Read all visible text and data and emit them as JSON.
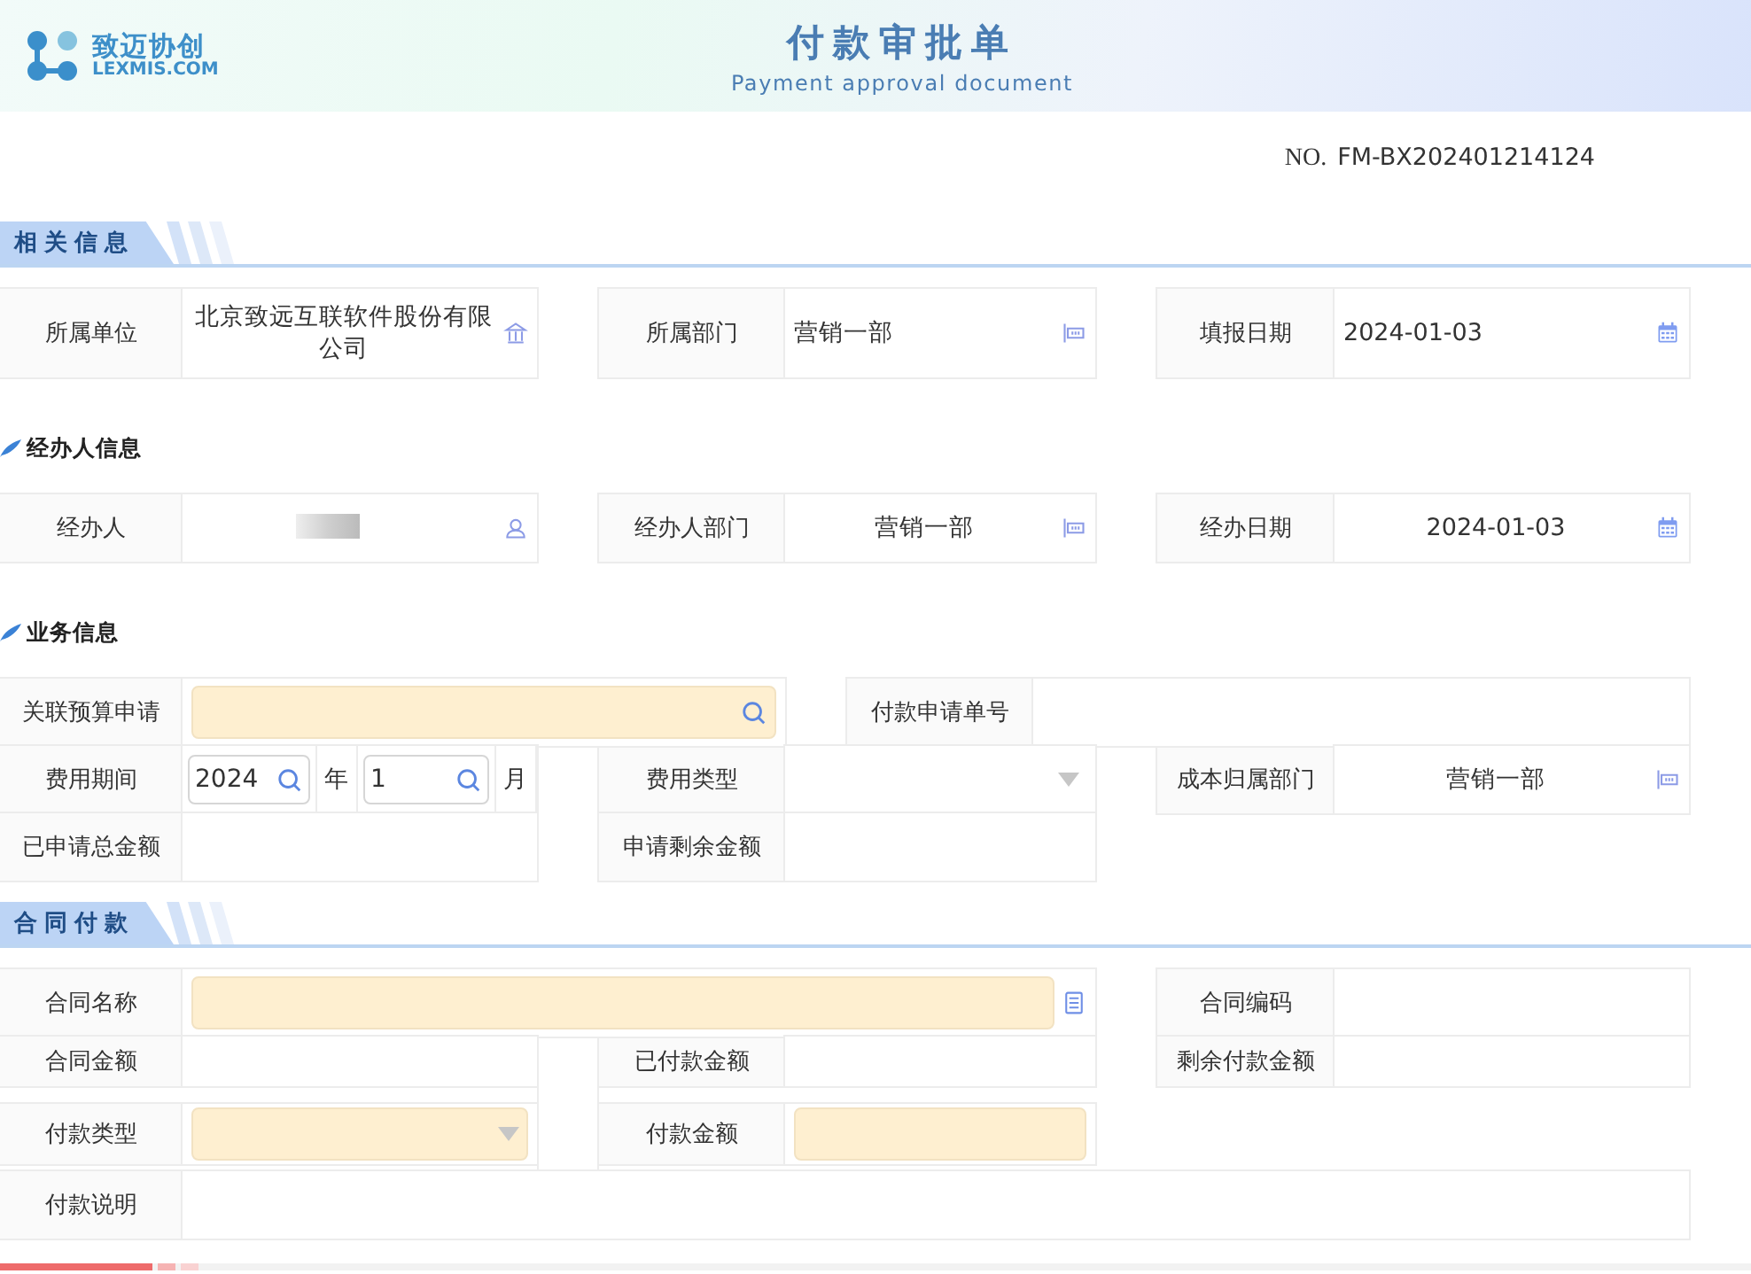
{
  "header": {
    "logo_name": "致迈协创",
    "logo_domain": "LEXMIS.COM",
    "title": "付款审批单",
    "subtitle": "Payment approval document"
  },
  "document_number": {
    "prefix": "NO.",
    "value": "FM-BX202401214124"
  },
  "sections": [
    {
      "kind": "banner",
      "title": "相关信息",
      "rows": [
        {
          "kind": "triple",
          "fields": [
            {
              "label": "所属单位",
              "value": {
                "kind": "company_picker",
                "text": "北京致远互联软件股份有限公司",
                "centered": true
              }
            },
            {
              "label": "所属部门",
              "value": {
                "kind": "department_picker",
                "text": "营销一部",
                "centered": false
              }
            },
            {
              "label": "填报日期",
              "value": {
                "kind": "date_picker",
                "text": "2024-01-03",
                "centered": false
              }
            }
          ]
        }
      ]
    },
    {
      "kind": "subheading",
      "title": "经办人信息",
      "rows": [
        {
          "kind": "triple",
          "fields": [
            {
              "label": "经办人",
              "value": {
                "kind": "person_picker"
              }
            },
            {
              "label": "经办人部门",
              "value": {
                "kind": "department_picker",
                "text": "营销一部",
                "centered": true
              }
            },
            {
              "label": "经办日期",
              "value": {
                "kind": "date_picker",
                "text": "2024-01-03",
                "centered": true
              }
            }
          ]
        }
      ]
    },
    {
      "kind": "subheading",
      "title": "业务信息",
      "rows": [
        {
          "kind": "budget",
          "fields": [
            {
              "label": "关联预算申请",
              "value": {
                "kind": "lookup",
                "required": true
              }
            },
            {
              "label": "付款申请单号",
              "value": {
                "kind": "text"
              }
            }
          ]
        },
        {
          "kind": "triple",
          "fields": [
            {
              "label": "费用期间",
              "value": {
                "kind": "period",
                "year": "2024",
                "year_unit": "年",
                "month": "1",
                "month_unit": "月"
              }
            },
            {
              "label": "费用类型",
              "value": {
                "kind": "select",
                "required": false
              }
            },
            {
              "label": "成本归属部门",
              "value": {
                "kind": "department_picker",
                "text": "营销一部",
                "centered": true
              }
            }
          ]
        },
        {
          "kind": "pair",
          "fields": [
            {
              "label": "已申请总金额",
              "value": {
                "kind": "text"
              }
            },
            {
              "label": "申请剩余金额",
              "value": {
                "kind": "text"
              }
            }
          ]
        }
      ]
    },
    {
      "kind": "banner",
      "title": "合同付款",
      "rows": [
        {
          "kind": "contract",
          "fields": [
            {
              "label": "合同名称",
              "value": {
                "kind": "contract_picker",
                "required": true
              }
            },
            {
              "label": "合同编码",
              "value": {
                "kind": "text"
              }
            }
          ]
        },
        {
          "kind": "triple_joined",
          "fields": [
            {
              "label": "合同金额",
              "value": {
                "kind": "text"
              }
            },
            {
              "label": "已付款金额",
              "value": {
                "kind": "text"
              }
            },
            {
              "label": "剩余付款金额",
              "value": {
                "kind": "text"
              }
            }
          ]
        },
        {
          "kind": "pair_joined",
          "fields": [
            {
              "label": "付款类型",
              "value": {
                "kind": "select",
                "required": true
              }
            },
            {
              "label": "付款金额",
              "value": {
                "kind": "input",
                "required": true
              }
            }
          ]
        },
        {
          "kind": "full",
          "fields": [
            {
              "label": "付款说明",
              "value": {
                "kind": "text"
              }
            }
          ]
        }
      ]
    }
  ]
}
